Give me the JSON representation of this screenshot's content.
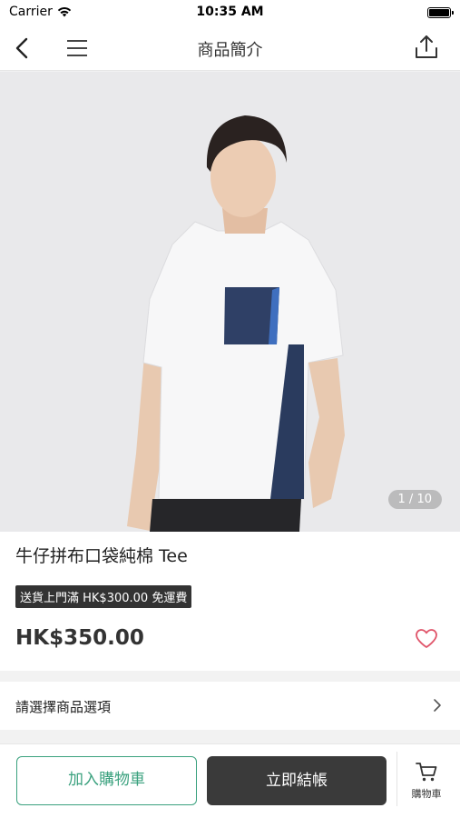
{
  "status_bar": {
    "carrier": "Carrier",
    "time": "10:35 AM"
  },
  "nav": {
    "title": "商品簡介",
    "icons": [
      "chevron-left-icon",
      "hamburger-menu-icon",
      "share-icon"
    ]
  },
  "gallery": {
    "counter": "1 / 10"
  },
  "product": {
    "name": "牛仔拼布口袋純棉 Tee",
    "promo": "送貨上門滿 HK$300.00 免運費",
    "price": "HK$350.00",
    "favorite_icon": "heart-outline-icon"
  },
  "options": {
    "label": "請選擇商品選項"
  },
  "bottom_bar": {
    "add_to_cart": "加入購物車",
    "checkout": "立即結帳",
    "cart_label": "購物車"
  },
  "colors": {
    "accent_green": "#3aa17e",
    "checkout_bg": "#3a3a3a",
    "heart": "#e0556a",
    "promo_bg": "#333333"
  }
}
